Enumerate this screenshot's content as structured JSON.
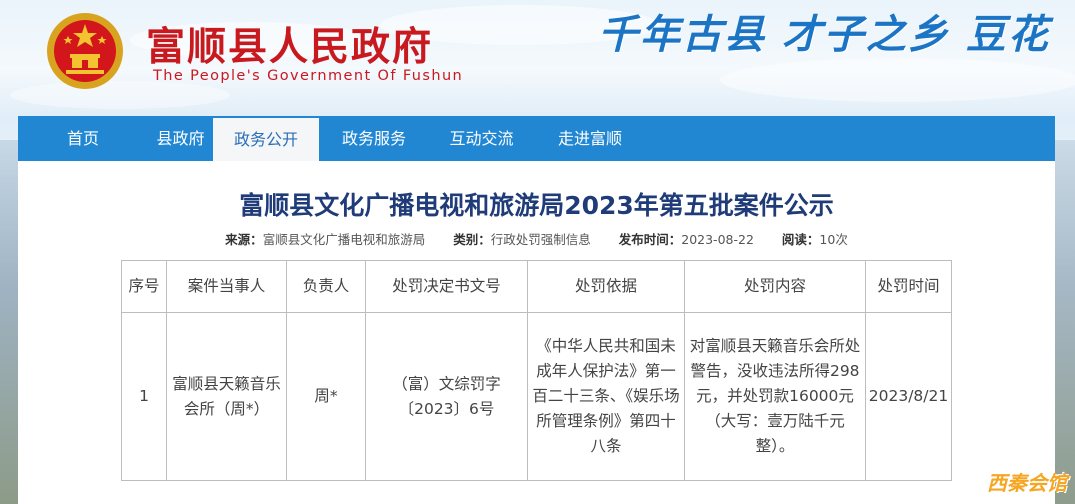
{
  "header": {
    "title": "富顺县人民政府",
    "subtitle": "The People's Government Of Fushun",
    "slogan": "千年古县  才子之乡  豆花"
  },
  "nav": {
    "items": [
      "首页",
      "县政府",
      "政务公开",
      "政务服务",
      "互动交流",
      "走进富顺"
    ],
    "active_index": 2
  },
  "article": {
    "title": "富顺县文化广播电视和旅游局2023年第五批案件公示",
    "meta": {
      "source_label": "来源：",
      "source": "富顺县文化广播电视和旅游局",
      "category_label": "类别：",
      "category": "行政处罚强制信息",
      "date_label": "发布时间：",
      "date": "2023-08-22",
      "reads_label": "阅读：",
      "reads": "10次"
    }
  },
  "table": {
    "headers": [
      "序号",
      "案件当事人",
      "负责人",
      "处罚决定书文号",
      "处罚依据",
      "处罚内容",
      "处罚时间"
    ],
    "rows": [
      [
        "1",
        "富顺县天籁音乐会所（周*）",
        "周*",
        "（富）文综罚字〔2023〕6号",
        "《中华人民共和国未成年人保护法》第一百二十三条、《娱乐场所管理条例》第四十八条",
        "对富顺县天籁音乐会所处警告，没收违法所得298元，并处罚款16000元（大写：壹万陆千元整）。",
        "2023/8/21"
      ]
    ]
  },
  "watermark": "西秦会馆",
  "colors": {
    "brand_red": "#c8191f",
    "nav_blue": "#2287d3",
    "title_navy": "#1f3c79"
  }
}
